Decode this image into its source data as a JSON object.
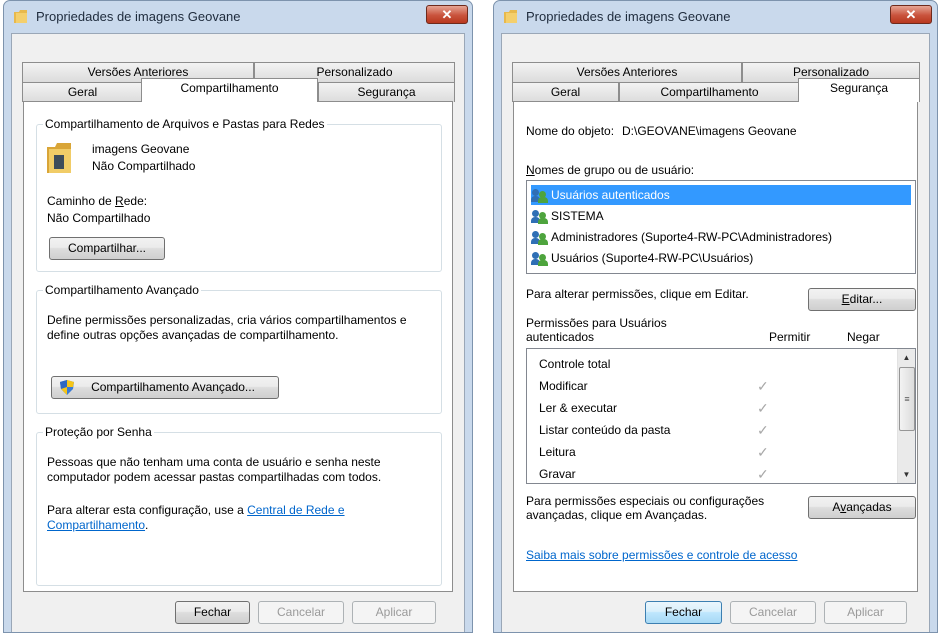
{
  "left_window": {
    "title": "Propriedades de imagens Geovane",
    "close_label": "✕",
    "tabs_top": [
      "Versões Anteriores",
      "Personalizado"
    ],
    "tabs_bottom": [
      "Geral",
      "Compartilhamento",
      "Segurança"
    ],
    "selected_tab": "Compartilhamento",
    "network_group": {
      "legend": "Compartilhamento de Arquivos e Pastas para Redes",
      "folder_name": "imagens Geovane",
      "folder_status": "Não Compartilhado",
      "path_label": "Caminho de Rede:",
      "path_value": "Não Compartilhado",
      "share_button": "Compartilhar..."
    },
    "advanced_group": {
      "legend": "Compartilhamento Avançado",
      "description": "Define permissões personalizadas, cria vários compartilhamentos e define outras opções avançadas de compartilhamento.",
      "button": "Compartilhamento Avançado..."
    },
    "password_group": {
      "legend": "Proteção por Senha",
      "description": "Pessoas que não tenham uma conta de usuário e senha neste computador podem acessar pastas compartilhadas com todos.",
      "change_text": "Para alterar esta configuração, use a ",
      "link_text": "Central de Rede e Compartilhamento",
      "trailing": "."
    },
    "buttons": {
      "close": "Fechar",
      "cancel": "Cancelar",
      "apply": "Aplicar"
    }
  },
  "right_window": {
    "title": "Propriedades de imagens Geovane",
    "close_label": "✕",
    "tabs_top": [
      "Versões Anteriores",
      "Personalizado"
    ],
    "tabs_bottom": [
      "Geral",
      "Compartilhamento",
      "Segurança"
    ],
    "selected_tab": "Segurança",
    "object_label": "Nome do objeto:",
    "object_value": "D:\\GEOVANE\\imagens Geovane",
    "groups_label": "Nomes de grupo ou de usuário:",
    "groups": [
      "Usuários autenticados",
      "SISTEMA",
      "Administradores (Suporte4-RW-PC\\Administradores)",
      "Usuários (Suporte4-RW-PC\\Usuários)"
    ],
    "edit_hint": "Para alterar permissões, clique em Editar.",
    "edit_button": "Editar...",
    "perm_header": "Permissões para Usuários autenticados",
    "col_allow": "Permitir",
    "col_deny": "Negar",
    "permissions": [
      {
        "name": "Controle total",
        "allow": ""
      },
      {
        "name": "Modificar",
        "allow": "✓"
      },
      {
        "name": "Ler & executar",
        "allow": "✓"
      },
      {
        "name": "Listar conteúdo da pasta",
        "allow": "✓"
      },
      {
        "name": "Leitura",
        "allow": "✓"
      },
      {
        "name": "Gravar",
        "allow": "✓"
      }
    ],
    "special_hint": "Para permissões especiais ou configurações avançadas, clique em Avançadas.",
    "advanced_button": "Avançadas",
    "learn_link": "Saiba mais sobre permissões e controle de acesso",
    "buttons": {
      "close": "Fechar",
      "cancel": "Cancelar",
      "apply": "Aplicar"
    }
  },
  "colors": {
    "title_bg": "#c9d9ec",
    "selection": "#3399ff",
    "link": "#0066cc",
    "close_button": "#c9533c"
  }
}
